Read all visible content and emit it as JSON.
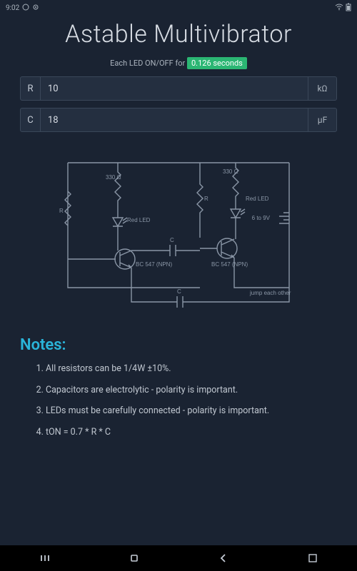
{
  "status": {
    "time": "9:02",
    "battery_icon": "battery"
  },
  "title": "Astable Multivibrator",
  "subtitle_prefix": "Each LED ON/OFF for ",
  "subtitle_value": "0.126 seconds",
  "inputs": {
    "r": {
      "label": "R",
      "value": "10",
      "unit": "kΩ"
    },
    "c": {
      "label": "C",
      "value": "18",
      "unit": "μF"
    }
  },
  "circuit": {
    "r_side": "R",
    "r330_left": "330 Ω",
    "r330_right": "330 Ω",
    "red_led_left": "Red LED",
    "red_led_right": "Red LED",
    "c_label": "C",
    "bc547_left": "BC 547 (NPN)",
    "bc547_right": "BC 547 (NPN)",
    "battery": "6 to 9V",
    "jump": "jump each other",
    "r_mid": "R"
  },
  "notes_heading": "Notes:",
  "notes": [
    "All resistors can be 1/4W ±10%.",
    "Capacitors are electrolytic - polarity is important.",
    "LEDs must be carefully connected - polarity is important.",
    "tON = 0.7 * R * C"
  ],
  "nav": {
    "recent": "recent",
    "home": "home",
    "back": "back",
    "extra": "screenshot"
  }
}
